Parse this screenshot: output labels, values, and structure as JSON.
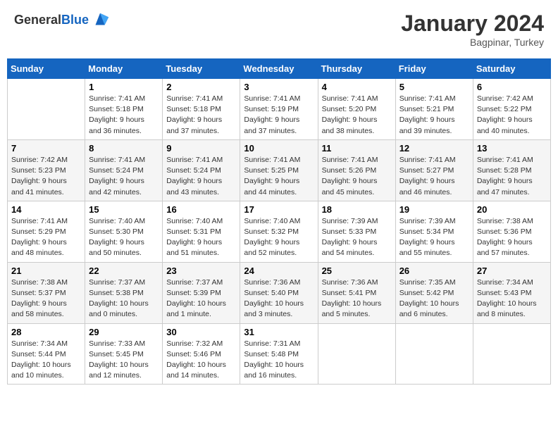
{
  "header": {
    "logo_general": "General",
    "logo_blue": "Blue",
    "month": "January 2024",
    "location": "Bagpinar, Turkey"
  },
  "weekdays": [
    "Sunday",
    "Monday",
    "Tuesday",
    "Wednesday",
    "Thursday",
    "Friday",
    "Saturday"
  ],
  "weeks": [
    [
      {
        "day": "",
        "info": ""
      },
      {
        "day": "1",
        "info": "Sunrise: 7:41 AM\nSunset: 5:18 PM\nDaylight: 9 hours\nand 36 minutes."
      },
      {
        "day": "2",
        "info": "Sunrise: 7:41 AM\nSunset: 5:18 PM\nDaylight: 9 hours\nand 37 minutes."
      },
      {
        "day": "3",
        "info": "Sunrise: 7:41 AM\nSunset: 5:19 PM\nDaylight: 9 hours\nand 37 minutes."
      },
      {
        "day": "4",
        "info": "Sunrise: 7:41 AM\nSunset: 5:20 PM\nDaylight: 9 hours\nand 38 minutes."
      },
      {
        "day": "5",
        "info": "Sunrise: 7:41 AM\nSunset: 5:21 PM\nDaylight: 9 hours\nand 39 minutes."
      },
      {
        "day": "6",
        "info": "Sunrise: 7:42 AM\nSunset: 5:22 PM\nDaylight: 9 hours\nand 40 minutes."
      }
    ],
    [
      {
        "day": "7",
        "info": "Sunrise: 7:42 AM\nSunset: 5:23 PM\nDaylight: 9 hours\nand 41 minutes."
      },
      {
        "day": "8",
        "info": "Sunrise: 7:41 AM\nSunset: 5:24 PM\nDaylight: 9 hours\nand 42 minutes."
      },
      {
        "day": "9",
        "info": "Sunrise: 7:41 AM\nSunset: 5:24 PM\nDaylight: 9 hours\nand 43 minutes."
      },
      {
        "day": "10",
        "info": "Sunrise: 7:41 AM\nSunset: 5:25 PM\nDaylight: 9 hours\nand 44 minutes."
      },
      {
        "day": "11",
        "info": "Sunrise: 7:41 AM\nSunset: 5:26 PM\nDaylight: 9 hours\nand 45 minutes."
      },
      {
        "day": "12",
        "info": "Sunrise: 7:41 AM\nSunset: 5:27 PM\nDaylight: 9 hours\nand 46 minutes."
      },
      {
        "day": "13",
        "info": "Sunrise: 7:41 AM\nSunset: 5:28 PM\nDaylight: 9 hours\nand 47 minutes."
      }
    ],
    [
      {
        "day": "14",
        "info": "Sunrise: 7:41 AM\nSunset: 5:29 PM\nDaylight: 9 hours\nand 48 minutes."
      },
      {
        "day": "15",
        "info": "Sunrise: 7:40 AM\nSunset: 5:30 PM\nDaylight: 9 hours\nand 50 minutes."
      },
      {
        "day": "16",
        "info": "Sunrise: 7:40 AM\nSunset: 5:31 PM\nDaylight: 9 hours\nand 51 minutes."
      },
      {
        "day": "17",
        "info": "Sunrise: 7:40 AM\nSunset: 5:32 PM\nDaylight: 9 hours\nand 52 minutes."
      },
      {
        "day": "18",
        "info": "Sunrise: 7:39 AM\nSunset: 5:33 PM\nDaylight: 9 hours\nand 54 minutes."
      },
      {
        "day": "19",
        "info": "Sunrise: 7:39 AM\nSunset: 5:34 PM\nDaylight: 9 hours\nand 55 minutes."
      },
      {
        "day": "20",
        "info": "Sunrise: 7:38 AM\nSunset: 5:36 PM\nDaylight: 9 hours\nand 57 minutes."
      }
    ],
    [
      {
        "day": "21",
        "info": "Sunrise: 7:38 AM\nSunset: 5:37 PM\nDaylight: 9 hours\nand 58 minutes."
      },
      {
        "day": "22",
        "info": "Sunrise: 7:37 AM\nSunset: 5:38 PM\nDaylight: 10 hours\nand 0 minutes."
      },
      {
        "day": "23",
        "info": "Sunrise: 7:37 AM\nSunset: 5:39 PM\nDaylight: 10 hours\nand 1 minute."
      },
      {
        "day": "24",
        "info": "Sunrise: 7:36 AM\nSunset: 5:40 PM\nDaylight: 10 hours\nand 3 minutes."
      },
      {
        "day": "25",
        "info": "Sunrise: 7:36 AM\nSunset: 5:41 PM\nDaylight: 10 hours\nand 5 minutes."
      },
      {
        "day": "26",
        "info": "Sunrise: 7:35 AM\nSunset: 5:42 PM\nDaylight: 10 hours\nand 6 minutes."
      },
      {
        "day": "27",
        "info": "Sunrise: 7:34 AM\nSunset: 5:43 PM\nDaylight: 10 hours\nand 8 minutes."
      }
    ],
    [
      {
        "day": "28",
        "info": "Sunrise: 7:34 AM\nSunset: 5:44 PM\nDaylight: 10 hours\nand 10 minutes."
      },
      {
        "day": "29",
        "info": "Sunrise: 7:33 AM\nSunset: 5:45 PM\nDaylight: 10 hours\nand 12 minutes."
      },
      {
        "day": "30",
        "info": "Sunrise: 7:32 AM\nSunset: 5:46 PM\nDaylight: 10 hours\nand 14 minutes."
      },
      {
        "day": "31",
        "info": "Sunrise: 7:31 AM\nSunset: 5:48 PM\nDaylight: 10 hours\nand 16 minutes."
      },
      {
        "day": "",
        "info": ""
      },
      {
        "day": "",
        "info": ""
      },
      {
        "day": "",
        "info": ""
      }
    ]
  ]
}
